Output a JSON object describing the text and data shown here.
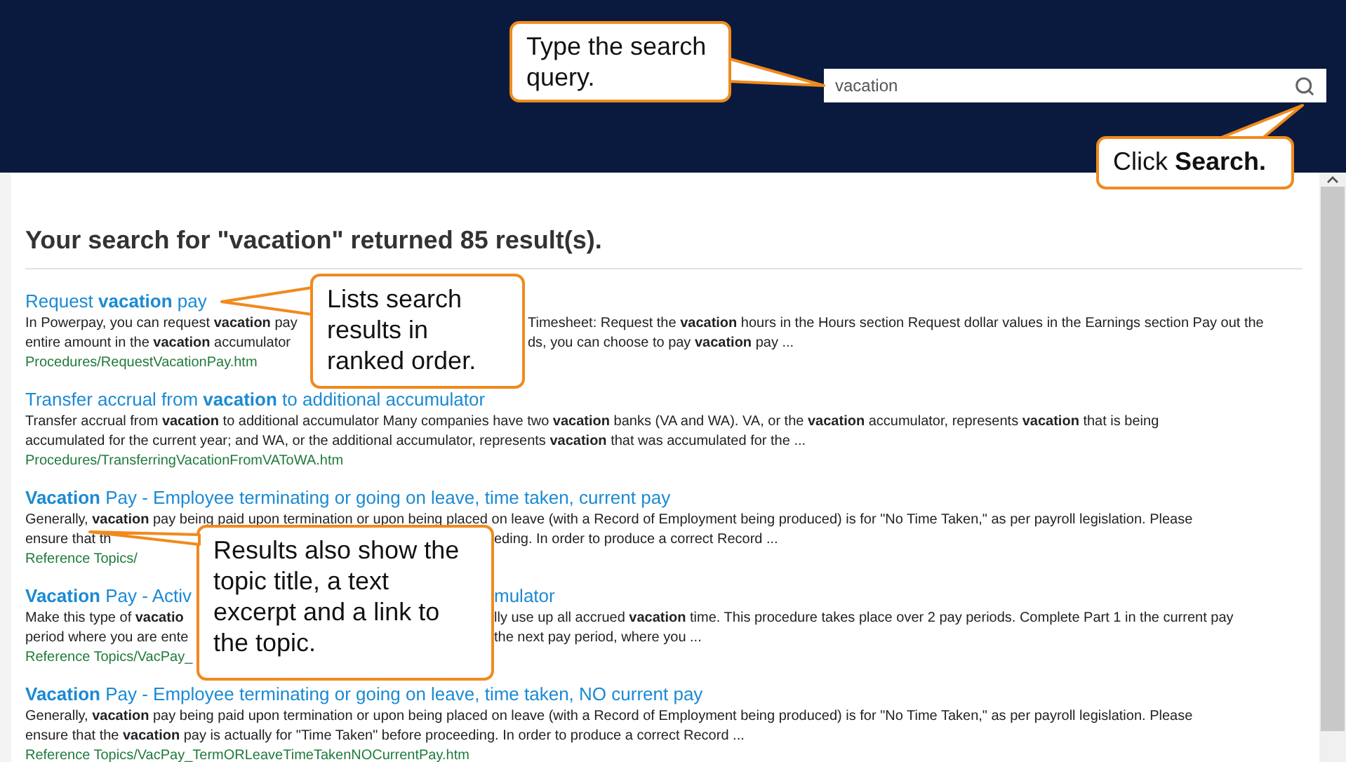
{
  "search": {
    "value": "vacation"
  },
  "heading": "Your search for \"vacation\" returned 85 result(s).",
  "results": [
    {
      "title": [
        "Request **vacation** pay"
      ],
      "lines": [
        [
          "In Powerpay, you can request **vacation** pay",
          "Timesheet: Request the **vacation** hours in the Hours section Request dollar values in the Earnings section Pay out the"
        ],
        [
          "entire amount in the **vacation** accumulator",
          "ds, you can choose to pay **vacation** pay ..."
        ]
      ],
      "link": "Procedures/RequestVacationPay.htm"
    },
    {
      "title": [
        "Transfer accrual from **vacation** to additional accumulator"
      ],
      "lines": [
        [
          "Transfer accrual from **vacation** to additional accumulator Many companies have two **vacation** banks (VA and WA). VA, or the **vacation** accumulator, represents **vacation** that is being"
        ],
        [
          "accumulated for the current year; and WA, or the additional accumulator, represents **vacation** that was accumulated for the ..."
        ]
      ],
      "link": "Procedures/TransferringVacationFromVAToWA.htm"
    },
    {
      "title": [
        "**Vacation** Pay - Employee terminating or going on leave, time taken, current pay"
      ],
      "lines": [
        [
          "Generally, **vacation** pay being paid upon termination or upon being placed on leave (with a Record of Employment being produced) is for \"No Time Taken,\" as per payroll legislation. Please"
        ],
        [
          "ensure that th",
          "eding. In order to produce a correct Record ..."
        ]
      ],
      "link": "Reference Topics/"
    },
    {
      "title": [
        "**Vacation** Pay - Activ",
        "mulator"
      ],
      "lines": [
        [
          "Make this type of **vacatio**",
          "lly use up all accrued **vacation** time. This procedure takes place over 2 pay periods. Complete Part 1 in the current pay"
        ],
        [
          "period where you are ente",
          "the next pay period, where you ..."
        ]
      ],
      "link": "Reference Topics/VacPay_"
    },
    {
      "title": [
        "**Vacation** Pay - Employee terminating or going on leave, time taken, NO current pay"
      ],
      "lines": [
        [
          "Generally, **vacation** pay being paid upon termination or upon being placed on leave (with a Record of Employment being produced) is for \"No Time Taken,\" as per payroll legislation. Please"
        ],
        [
          "ensure that the **vacation** pay is actually for \"Time Taken\" before proceeding. In order to produce a correct Record ..."
        ]
      ],
      "link": "Reference Topics/VacPay_TermORLeaveTimeTakenNOCurrentPay.htm"
    }
  ],
  "callouts": [
    {
      "text": "Type the search query."
    },
    {
      "text": "Click **Search.**"
    },
    {
      "text": "Lists search results in ranked order."
    },
    {
      "text": "Results also show the topic title, a text excerpt and a link to the topic."
    }
  ]
}
